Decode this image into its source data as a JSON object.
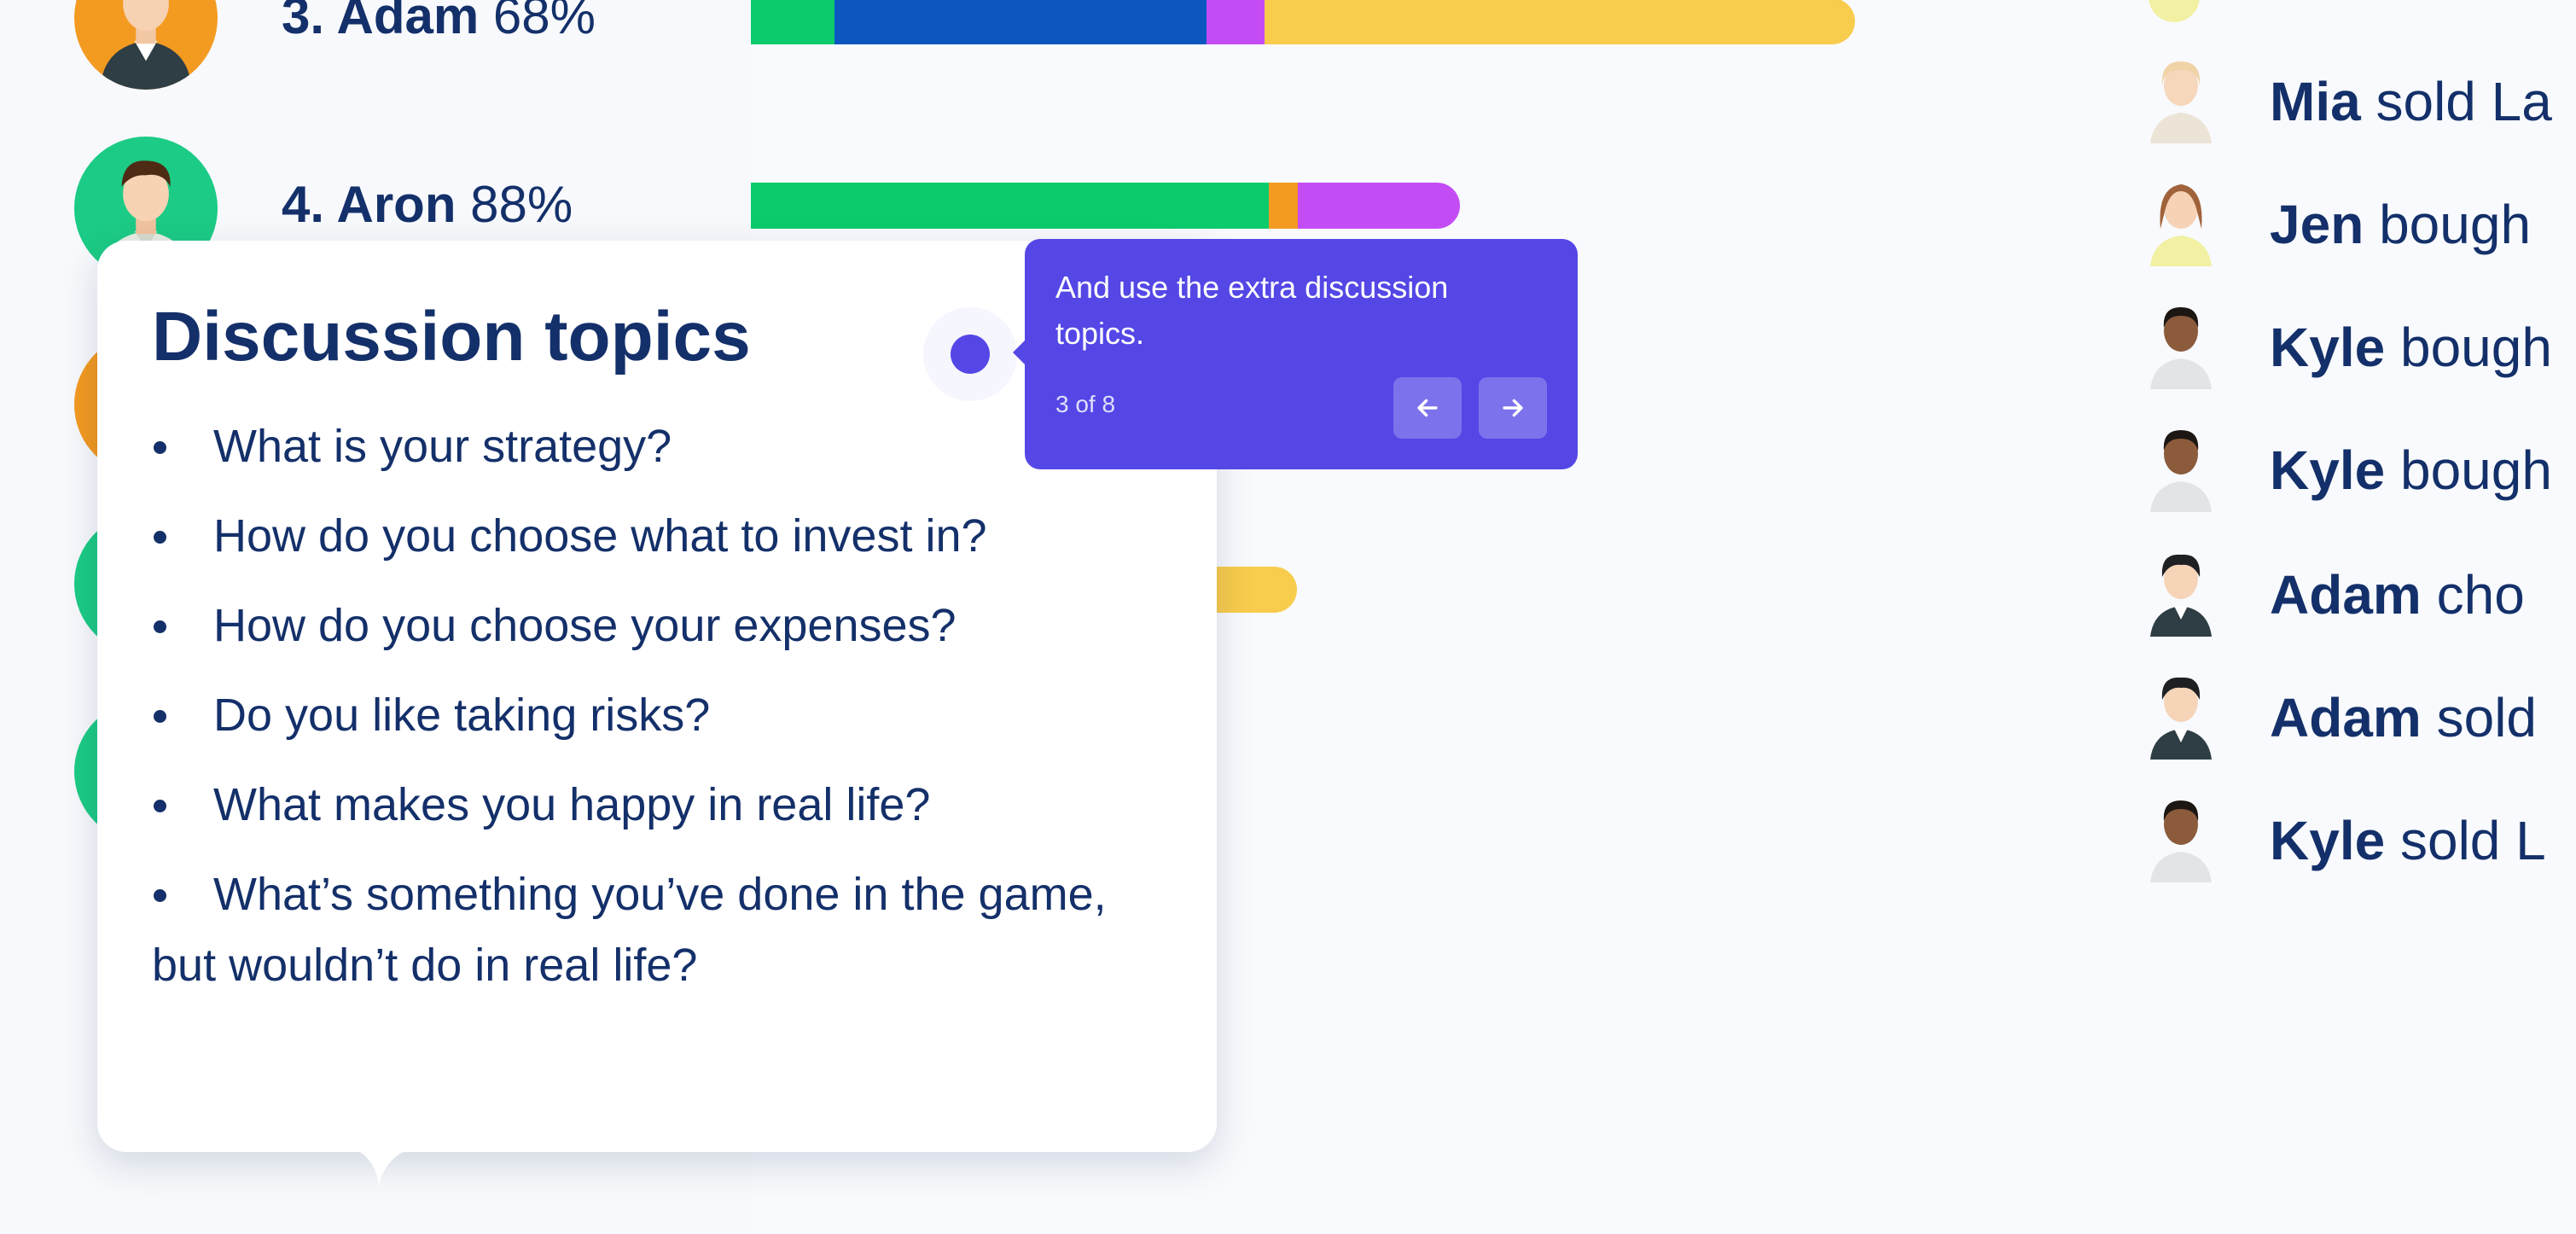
{
  "leaderboard": {
    "rows": [
      {
        "name": "3. Adam",
        "score": "68%"
      },
      {
        "name": "4. Aron",
        "score": "88%"
      }
    ]
  },
  "colors": {
    "navy": "#14306a",
    "green": "#0ccb6d",
    "blue": "#0b57bf",
    "magenta": "#c44cf5",
    "yellow": "#f8cc4c",
    "orange": "#f39a21",
    "tour_purple": "#5447e6"
  },
  "activity_feed": {
    "items": [
      {
        "name": "Mia",
        "text": "sold La"
      },
      {
        "name": "Jen",
        "text": "bough"
      },
      {
        "name": "Kyle",
        "text": "bough"
      },
      {
        "name": "Kyle",
        "text": "bough"
      },
      {
        "name": "Adam",
        "text": "cho"
      },
      {
        "name": "Adam",
        "text": "sold"
      },
      {
        "name": "Kyle",
        "text": "sold L"
      }
    ]
  },
  "discussion": {
    "title": "Discussion topics",
    "topics": [
      "What is your strategy?",
      "How do you choose what to invest in?",
      "How do you choose your expenses?",
      "Do you like taking risks?",
      "What makes you happy in real life?",
      "What’s something you’ve done in the game, but wouldn’t do in real life?"
    ]
  },
  "tour": {
    "message": "And use the extra discussion topics.",
    "step": "3 of 8",
    "prev_icon": "arrow-left-icon",
    "next_icon": "arrow-right-icon"
  }
}
